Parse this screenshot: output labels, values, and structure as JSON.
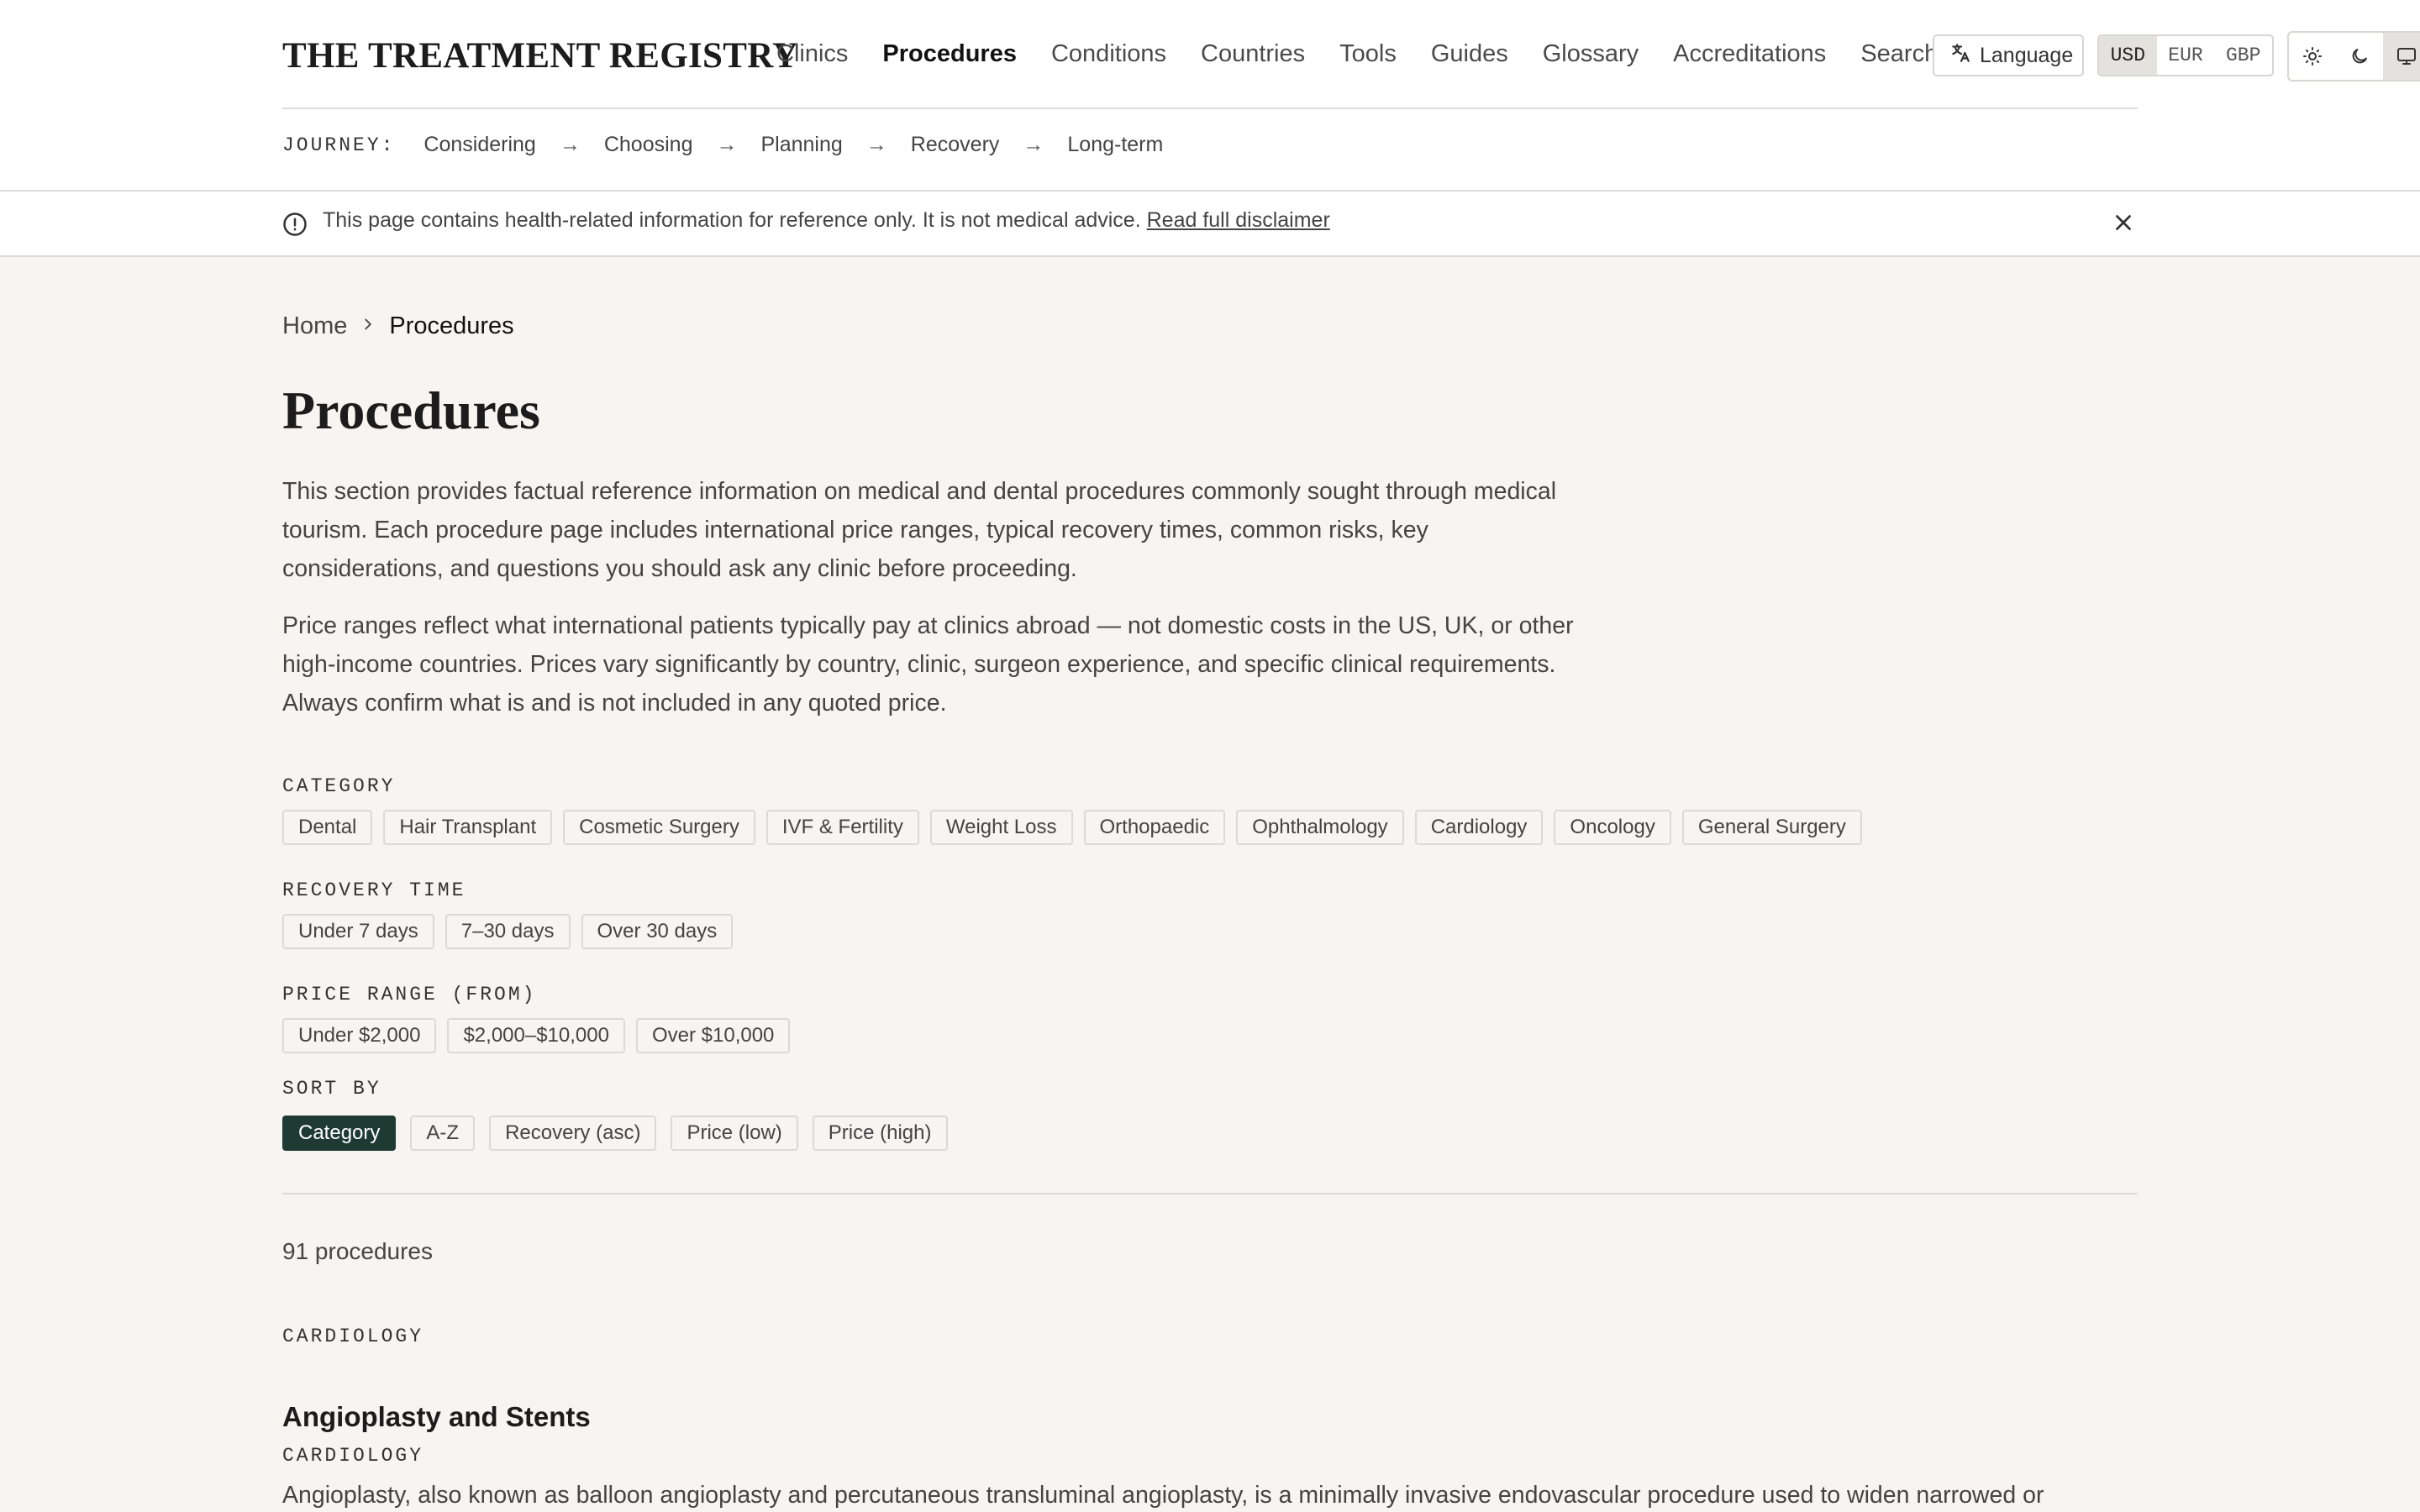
{
  "header": {
    "logo": "THE TREATMENT REGISTRY",
    "nav": [
      "Clinics",
      "Procedures",
      "Conditions",
      "Countries",
      "Tools",
      "Guides",
      "Glossary",
      "Accreditations",
      "Search"
    ],
    "active_nav": "Procedures",
    "language_label": "Language",
    "currencies": [
      "USD",
      "EUR",
      "GBP"
    ],
    "active_currency": "USD",
    "theme_icons": [
      "sun-icon",
      "moon-icon",
      "monitor-icon"
    ]
  },
  "journey": {
    "label": "JOURNEY:",
    "steps": [
      "Considering",
      "Choosing",
      "Planning",
      "Recovery",
      "Long-term"
    ],
    "arrow": "→"
  },
  "disclaimer": {
    "text": "This page contains health-related information for reference only. It is not medical advice.",
    "link": "Read full disclaimer"
  },
  "breadcrumb": {
    "home": "Home",
    "current": "Procedures"
  },
  "page": {
    "title": "Procedures",
    "intro_1": "This section provides factual reference information on medical and dental procedures commonly sought through medical tourism. Each procedure page includes international price ranges, typical recovery times, common risks, key considerations, and questions you should ask any clinic before proceeding.",
    "intro_2": "Price ranges reflect what international patients typically pay at clinics abroad — not domestic costs in the US, UK, or other high-income countries. Prices vary significantly by country, clinic, surgeon experience, and specific clinical requirements. Always confirm what is and is not included in any quoted price."
  },
  "filters": {
    "category_label": "CATEGORY",
    "categories": [
      "Dental",
      "Hair Transplant",
      "Cosmetic Surgery",
      "IVF & Fertility",
      "Weight Loss",
      "Orthopaedic",
      "Ophthalmology",
      "Cardiology",
      "Oncology",
      "General Surgery"
    ],
    "recovery_label": "RECOVERY TIME",
    "recovery": [
      "Under 7 days",
      "7–30 days",
      "Over 30 days"
    ],
    "price_label": "PRICE RANGE (FROM)",
    "price": [
      "Under $2,000",
      "$2,000–$10,000",
      "Over $10,000"
    ],
    "sort_label": "SORT BY",
    "sort": [
      "Category",
      "A-Z",
      "Recovery (asc)",
      "Price (low)",
      "Price (high)"
    ],
    "active_sort": "Category"
  },
  "results": {
    "count": "91 procedures",
    "group": "CARDIOLOGY",
    "first": {
      "title": "Angioplasty and Stents",
      "category": "CARDIOLOGY",
      "description": "Angioplasty, also known as balloon angioplasty and percutaneous transluminal angioplasty, is a minimally invasive endovascular procedure used to widen narrowed or"
    }
  },
  "colors": {
    "accent": "#1e3a32",
    "background": "#f7f5f1"
  }
}
